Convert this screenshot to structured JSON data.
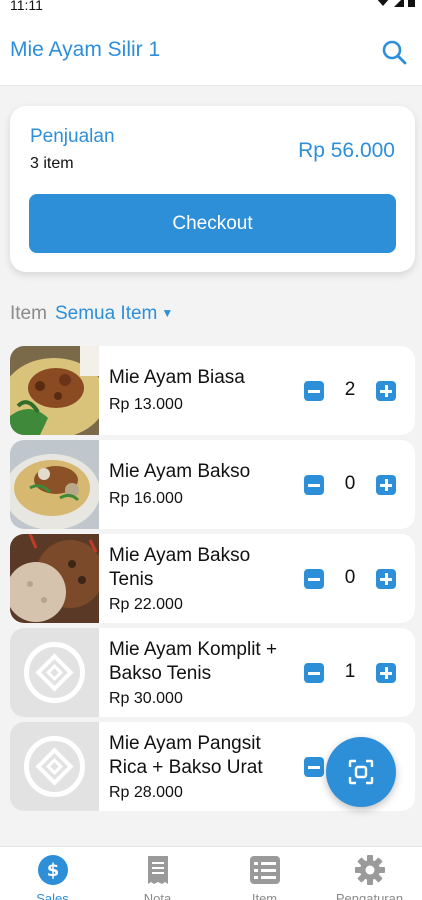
{
  "status_bar": {
    "time": "11:11"
  },
  "header": {
    "title": "Mie Ayam Silir 1",
    "search_icon": "search-icon"
  },
  "summary": {
    "title": "Penjualan",
    "count": "3 item",
    "total": "Rp 56.000",
    "checkout_label": "Checkout"
  },
  "filter": {
    "label": "Item",
    "selected": "Semua Item"
  },
  "items": [
    {
      "name": "Mie Ayam Biasa",
      "price": "Rp 13.000",
      "qty": "2",
      "image": "photo"
    },
    {
      "name": "Mie Ayam Bakso",
      "price": "Rp 16.000",
      "qty": "0",
      "image": "photo"
    },
    {
      "name": "Mie Ayam Bakso Tenis",
      "price": "Rp 22.000",
      "qty": "0",
      "image": "photo"
    },
    {
      "name": "Mie Ayam Komplit + Bakso Tenis",
      "price": "Rp 30.000",
      "qty": "1",
      "image": "placeholder"
    },
    {
      "name": "Mie Ayam Pangsit Rica + Bakso Urat",
      "price": "Rp 28.000",
      "qty": "",
      "image": "placeholder"
    }
  ],
  "fab": {
    "icon": "scan-icon"
  },
  "bottom_nav": [
    {
      "label": "Sales",
      "icon": "dollar-icon",
      "active": true
    },
    {
      "label": "Nota",
      "icon": "receipt-icon",
      "active": false
    },
    {
      "label": "Item",
      "icon": "list-icon",
      "active": false
    },
    {
      "label": "Pengaturan",
      "icon": "gear-icon",
      "active": false
    }
  ],
  "colors": {
    "accent": "#2e8fd9",
    "background": "#f3f3f3",
    "muted": "#8a8a8a"
  }
}
